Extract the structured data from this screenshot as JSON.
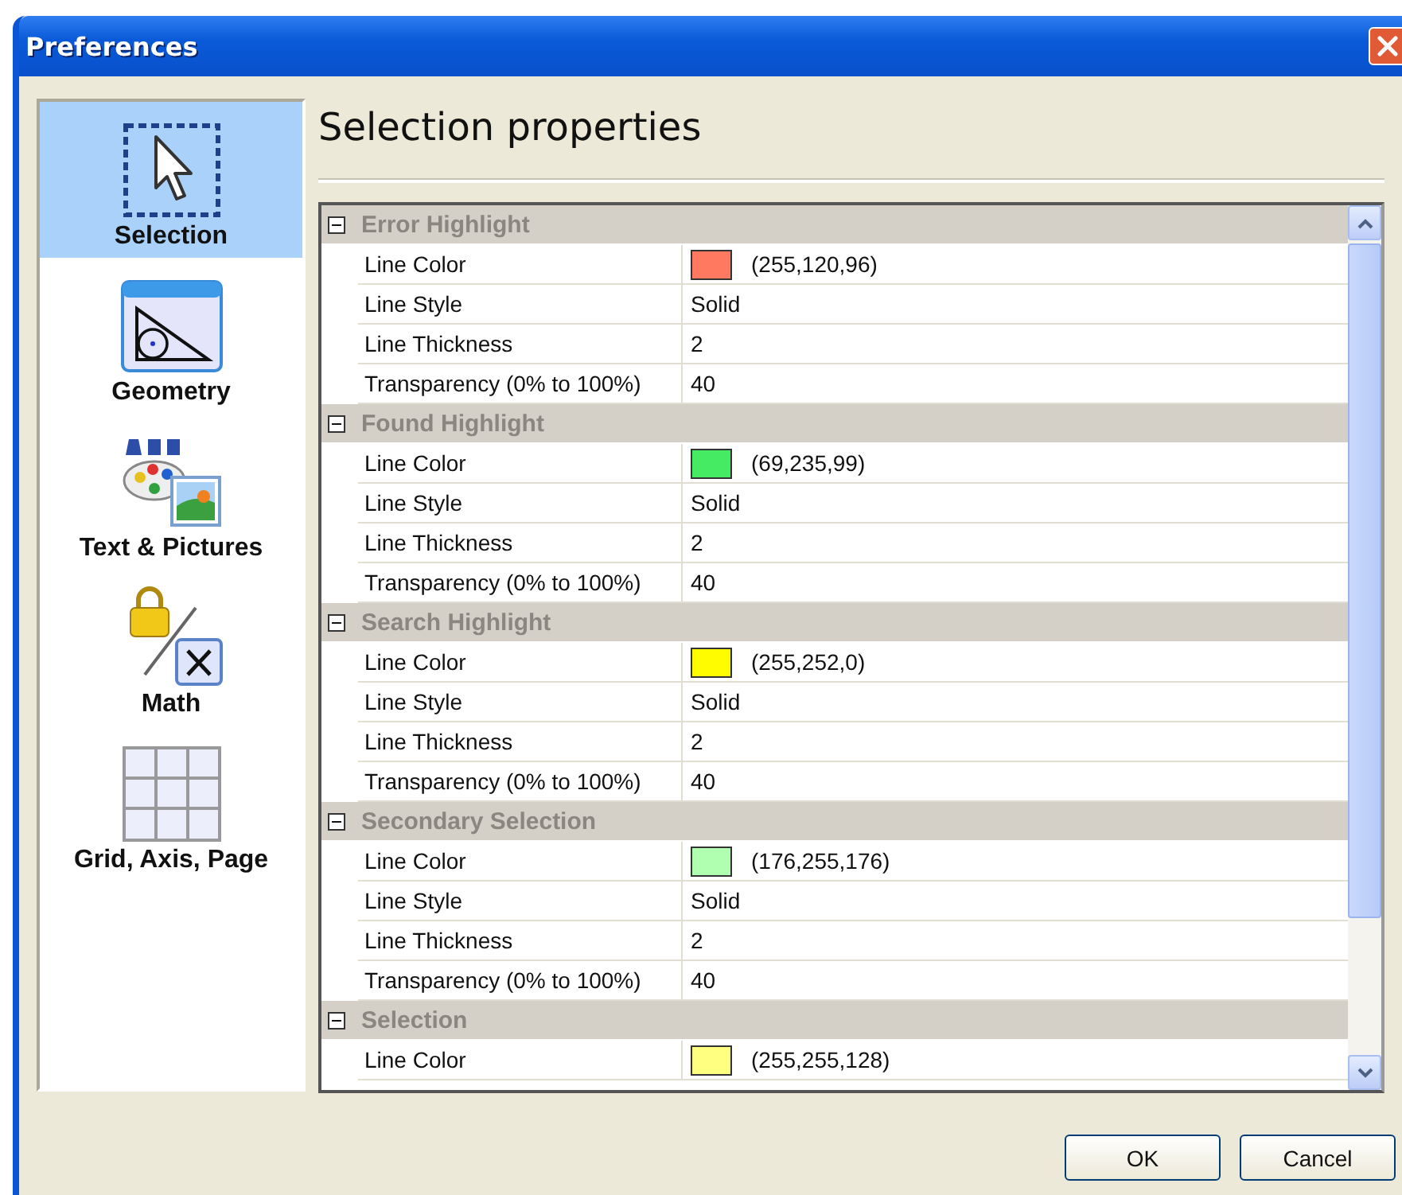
{
  "window": {
    "title": "Preferences"
  },
  "sidebar": {
    "items": [
      {
        "label": "Selection",
        "kind": "selection",
        "selected": true
      },
      {
        "label": "Geometry",
        "kind": "geometry",
        "selected": false
      },
      {
        "label": "Text & Pictures",
        "kind": "text",
        "selected": false
      },
      {
        "label": "Math",
        "kind": "math",
        "selected": false
      },
      {
        "label": "Grid, Axis, Page",
        "kind": "grid",
        "selected": false
      }
    ]
  },
  "heading": "Selection properties",
  "groups": [
    {
      "title": "Error Highlight",
      "expanded": true,
      "properties": [
        {
          "name": "Line Color",
          "kind": "color",
          "color": "#ff7860",
          "value": "(255,120,96)"
        },
        {
          "name": "Line Style",
          "kind": "text",
          "value": "Solid"
        },
        {
          "name": "Line Thickness",
          "kind": "text",
          "value": "2"
        },
        {
          "name": "Transparency (0% to 100%)",
          "kind": "text",
          "value": "40"
        }
      ]
    },
    {
      "title": "Found Highlight",
      "expanded": true,
      "properties": [
        {
          "name": "Line Color",
          "kind": "color",
          "color": "#45eb63",
          "value": "(69,235,99)"
        },
        {
          "name": "Line Style",
          "kind": "text",
          "value": "Solid"
        },
        {
          "name": "Line Thickness",
          "kind": "text",
          "value": "2"
        },
        {
          "name": "Transparency (0% to 100%)",
          "kind": "text",
          "value": "40"
        }
      ]
    },
    {
      "title": "Search Highlight",
      "expanded": true,
      "properties": [
        {
          "name": "Line Color",
          "kind": "color",
          "color": "#fffc00",
          "value": "(255,252,0)"
        },
        {
          "name": "Line Style",
          "kind": "text",
          "value": "Solid"
        },
        {
          "name": "Line Thickness",
          "kind": "text",
          "value": "2"
        },
        {
          "name": "Transparency (0% to 100%)",
          "kind": "text",
          "value": "40"
        }
      ]
    },
    {
      "title": "Secondary Selection",
      "expanded": true,
      "properties": [
        {
          "name": "Line Color",
          "kind": "color",
          "color": "#b0ffb0",
          "value": "(176,255,176)"
        },
        {
          "name": "Line Style",
          "kind": "text",
          "value": "Solid"
        },
        {
          "name": "Line Thickness",
          "kind": "text",
          "value": "2"
        },
        {
          "name": "Transparency (0% to 100%)",
          "kind": "text",
          "value": "40"
        }
      ]
    },
    {
      "title": "Selection",
      "expanded": true,
      "properties": [
        {
          "name": "Line Color",
          "kind": "color",
          "color": "#ffff80",
          "value": "(255,255,128)"
        }
      ]
    }
  ],
  "buttons": [
    "OK",
    "Cancel"
  ]
}
